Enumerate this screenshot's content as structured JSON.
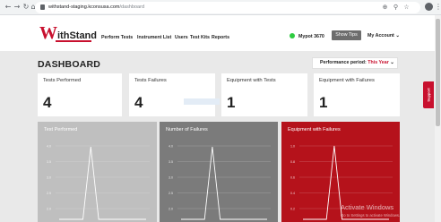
{
  "browser": {
    "url_host": "withstand-staging.kconsusa.com",
    "url_path": "/dashboard",
    "back_icon": "back-arrow-icon",
    "forward_icon": "forward-arrow-icon",
    "reload_icon": "reload-icon",
    "home_icon": "home-icon"
  },
  "header": {
    "logo_w": "W",
    "logo_rest": "ithStand",
    "nav": [
      "Perform Tests",
      "Instrument List",
      "Users",
      "Test Kits",
      "Reports"
    ],
    "site": "Mypot 3670",
    "tips_button": "Show Tips",
    "account": "My Account"
  },
  "dashboard": {
    "title": "DASHBOARD",
    "period_label": "Performance period:",
    "period_value": "This Year",
    "cards": [
      {
        "title": "Tests Performed",
        "value": "4"
      },
      {
        "title": "Tests Failures",
        "value": "4"
      },
      {
        "title": "Equipment with Tests",
        "value": "1"
      },
      {
        "title": "Equipment with Failures",
        "value": "1"
      }
    ],
    "support_label": "Support"
  },
  "panels": [
    {
      "title": "Test Performed",
      "bg": "#bfbfbf"
    },
    {
      "title": "Number of Failures",
      "bg": "#7b7b7b"
    },
    {
      "title": "Equipment with Failures",
      "bg": "#b5121b"
    }
  ],
  "chart_data": [
    {
      "type": "line",
      "title": "Test Performed",
      "y_tick_labels": [
        "4.0",
        "3.5",
        "3.0",
        "2.5",
        "2.0",
        "1.5"
      ],
      "ylim": [
        1.2,
        4.1
      ],
      "values": [
        0,
        0,
        0,
        0,
        4,
        0,
        0,
        0,
        0,
        0,
        0,
        0
      ],
      "grid": true
    },
    {
      "type": "line",
      "title": "Number of Failures",
      "y_tick_labels": [
        "4.0",
        "3.5",
        "3.0",
        "2.5",
        "2.0",
        "1.5"
      ],
      "ylim": [
        1.2,
        4.1
      ],
      "values": [
        0,
        0,
        0,
        0,
        4,
        0,
        0,
        0,
        0,
        0,
        0,
        0
      ],
      "grid": true
    },
    {
      "type": "line",
      "title": "Equipment with Failures",
      "y_tick_labels": [
        "1.0",
        "0.8",
        "0.6",
        "0.4",
        "0.2",
        "0.2"
      ],
      "ylim": [
        0.12,
        1.02
      ],
      "values": [
        0,
        0,
        0,
        0,
        1,
        0,
        0,
        0,
        0,
        0,
        0,
        0
      ],
      "grid": true
    }
  ],
  "watermark": {
    "line1": "Activate Windows",
    "line2": "Go to Settings to activate Windows."
  },
  "colors": {
    "brand_red": "#c8102e",
    "site_status": "#2ecc40"
  }
}
